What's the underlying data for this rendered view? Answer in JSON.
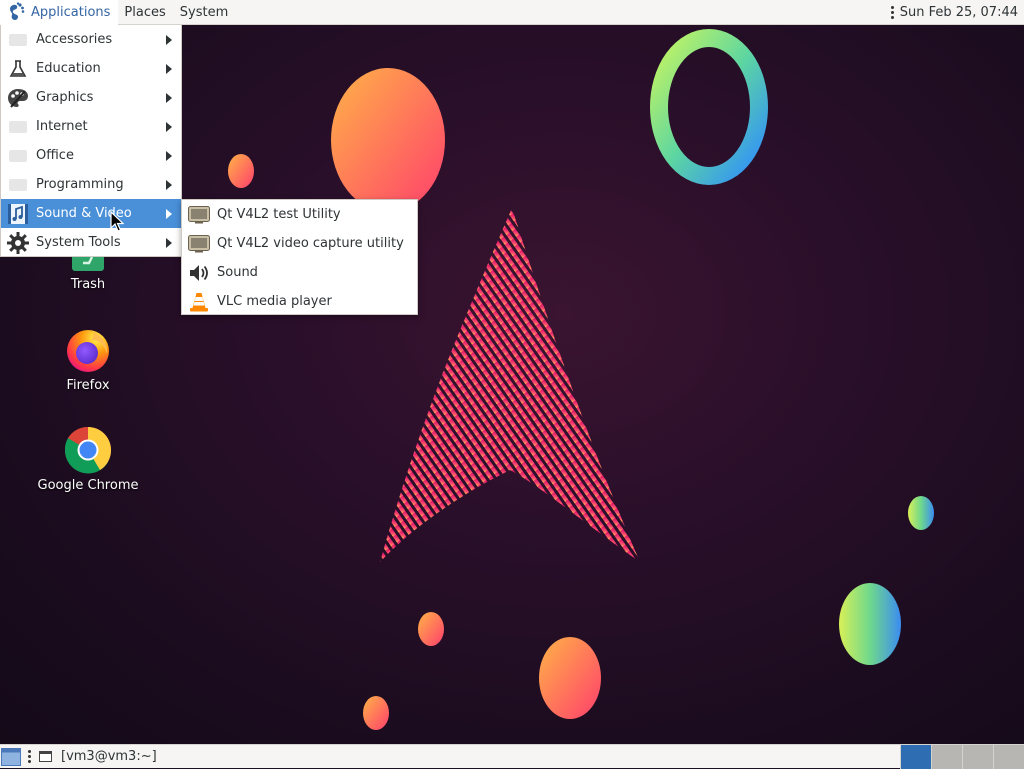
{
  "top_panel": {
    "menus": [
      {
        "label": "Applications",
        "icon": "gnome-foot-icon",
        "active": true
      },
      {
        "label": "Places"
      },
      {
        "label": "System"
      }
    ],
    "clock": "Sun Feb 25, 07:44"
  },
  "applications_menu": {
    "items": [
      {
        "label": "Accessories",
        "icon": "accessories-icon"
      },
      {
        "label": "Education",
        "icon": "flask-icon"
      },
      {
        "label": "Graphics",
        "icon": "palette-icon"
      },
      {
        "label": "Internet",
        "icon": "internet-icon"
      },
      {
        "label": "Office",
        "icon": "office-icon"
      },
      {
        "label": "Programming",
        "icon": "programming-icon"
      },
      {
        "label": "Sound & Video",
        "icon": "music-film-icon",
        "selected": true
      },
      {
        "label": "System Tools",
        "icon": "gear-icon"
      }
    ]
  },
  "sound_video_submenu": {
    "items": [
      {
        "label": "Qt V4L2 test Utility",
        "icon": "tv-icon"
      },
      {
        "label": "Qt V4L2 video capture utility",
        "icon": "tv-icon"
      },
      {
        "label": "Sound",
        "icon": "speaker-icon"
      },
      {
        "label": "VLC media player",
        "icon": "vlc-cone-icon"
      }
    ]
  },
  "desktop_icons": [
    {
      "label": "Trash",
      "icon": "trash-icon"
    },
    {
      "label": "Firefox",
      "icon": "firefox-icon"
    },
    {
      "label": "Google Chrome",
      "icon": "chrome-icon"
    }
  ],
  "bottom_panel": {
    "task_label": "[vm3@vm3:~]",
    "workspaces": 4,
    "active_workspace": 1
  },
  "colors": {
    "menu_selected": "#4a90d9",
    "panel_bg": "#f6f5f4",
    "active_menu_text": "#3465a4",
    "workspace_active": "#2f6db2"
  }
}
